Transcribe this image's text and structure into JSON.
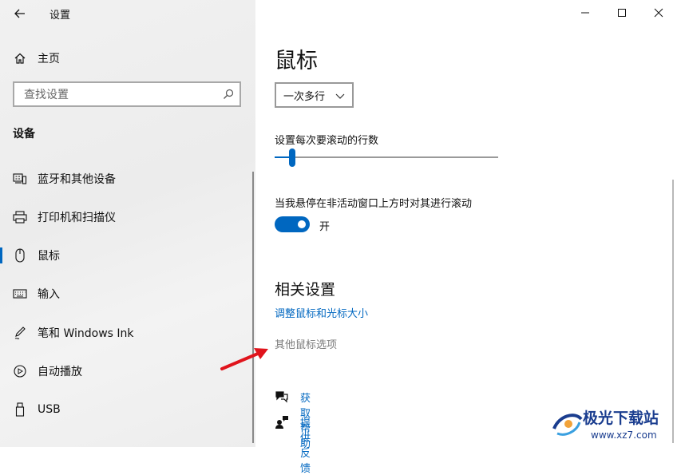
{
  "window": {
    "title": "设置"
  },
  "sidebar": {
    "home_label": "主页",
    "search_placeholder": "查找设置",
    "section_title": "设备",
    "items": [
      {
        "label": "蓝牙和其他设备",
        "icon": "bluetooth-devices-icon"
      },
      {
        "label": "打印机和扫描仪",
        "icon": "printer-icon"
      },
      {
        "label": "鼠标",
        "icon": "mouse-icon",
        "active": true
      },
      {
        "label": "输入",
        "icon": "keyboard-icon"
      },
      {
        "label": "笔和 Windows Ink",
        "icon": "pen-icon"
      },
      {
        "label": "自动播放",
        "icon": "autoplay-icon"
      },
      {
        "label": "USB",
        "icon": "usb-icon"
      }
    ]
  },
  "main": {
    "title": "鼠标",
    "scroll_mode_selected": "一次多行",
    "lines_label": "设置每次要滚动的行数",
    "lines_slider_fraction": 0.08,
    "inactive_scroll_label": "当我悬停在非活动窗口上方时对其进行滚动",
    "inactive_scroll_state": "开",
    "related_title": "相关设置",
    "related_links": [
      "调整鼠标和光标大小",
      "其他鼠标选项"
    ],
    "help_links": [
      "获取帮助",
      "提供反馈"
    ]
  },
  "watermark": {
    "name": "极光下载站",
    "url": "www.xz7.com"
  },
  "colors": {
    "accent": "#0067c0",
    "arrow": "#e0141c"
  }
}
